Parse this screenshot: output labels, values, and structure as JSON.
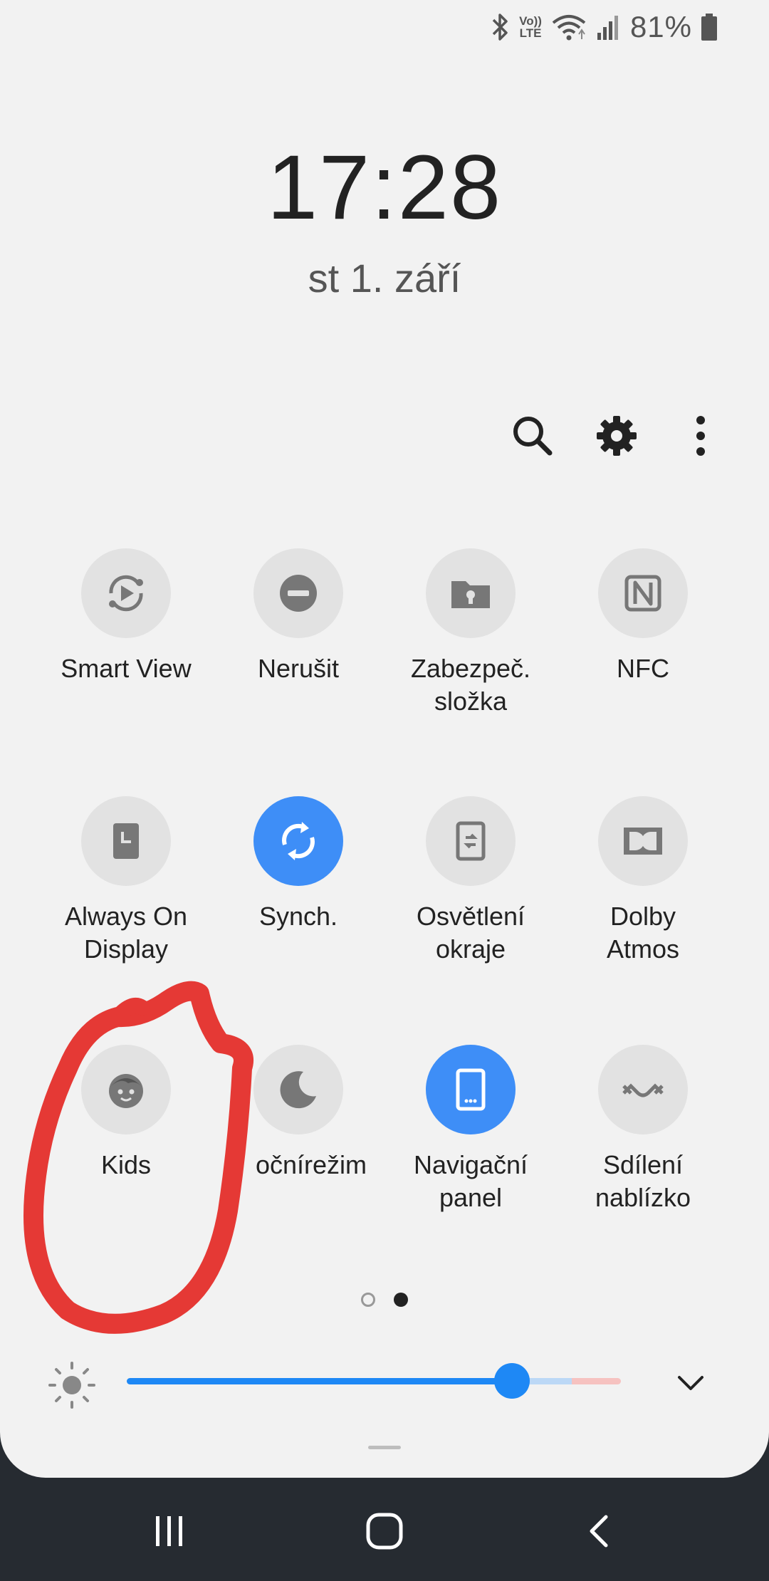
{
  "status_bar": {
    "volte_label_top": "Vo))",
    "volte_label_bottom": "LTE",
    "battery_percent": "81%",
    "icons": [
      "bluetooth-icon",
      "volte-icon",
      "wifi-icon",
      "signal-icon",
      "battery-icon"
    ]
  },
  "clock": {
    "time": "17:28",
    "date": "st 1. září"
  },
  "toolbar": {
    "icons": [
      "search-icon",
      "gear-icon",
      "more-vert-icon"
    ]
  },
  "tiles": [
    {
      "label": "Smart View",
      "icon": "smart-view-icon",
      "active": false
    },
    {
      "label": "Nerušit",
      "icon": "do-not-disturb-icon",
      "active": false
    },
    {
      "label": "Zabezpeč.\nsložka",
      "icon": "secure-folder-icon",
      "active": false
    },
    {
      "label": "NFC",
      "icon": "nfc-icon",
      "active": false
    },
    {
      "label": "Always On\nDisplay",
      "icon": "always-on-display-icon",
      "active": false
    },
    {
      "label": "Synch.",
      "icon": "sync-icon",
      "active": true
    },
    {
      "label": "Osvětlení\nokraje",
      "icon": "edge-lighting-icon",
      "active": false
    },
    {
      "label": "Dolby\nAtmos",
      "icon": "dolby-icon",
      "active": false
    },
    {
      "label": "Kids",
      "icon": "kids-icon",
      "active": false
    },
    {
      "label": "očnírežim",
      "icon": "night-mode-icon",
      "active": false
    },
    {
      "label": "Navigační\npanel",
      "icon": "navigation-bar-icon",
      "active": true
    },
    {
      "label": "Sdílení\nnablízko",
      "icon": "nearby-share-icon",
      "active": false
    }
  ],
  "pager": {
    "pages": 2,
    "current": 2
  },
  "brightness": {
    "level": 0.78
  },
  "colors": {
    "accent": "#3e8ef7",
    "annotation": "#e53935",
    "panel": "#f2f2f2",
    "navbar": "#262b31"
  },
  "navbar": {
    "icons": [
      "recents-icon",
      "home-icon",
      "back-icon"
    ]
  }
}
